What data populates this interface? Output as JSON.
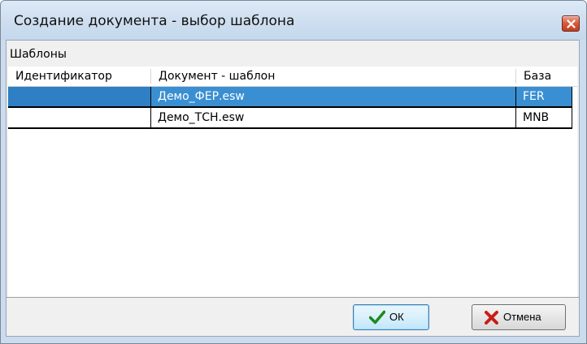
{
  "window": {
    "title": "Создание документа - выбор шаблона"
  },
  "group": {
    "label": "Шаблоны"
  },
  "grid": {
    "columns": [
      "Идентификатор",
      "Документ - шаблон",
      "База"
    ],
    "rows": [
      {
        "id": "",
        "document": "Демо_ФЕР.esw",
        "base": "FER",
        "selected": true
      },
      {
        "id": "",
        "document": "Демо_ТСН.esw",
        "base": "MNB",
        "selected": false
      }
    ]
  },
  "buttons": {
    "ok_label": "ОК",
    "cancel_label": "Отмена"
  },
  "colors": {
    "selection": "#3a8fd2",
    "title_bar": "#cfdff0",
    "close_button": "#d6583a"
  },
  "icons": {
    "close": "close-icon",
    "ok": "checkmark-icon",
    "cancel": "red-x-icon"
  }
}
